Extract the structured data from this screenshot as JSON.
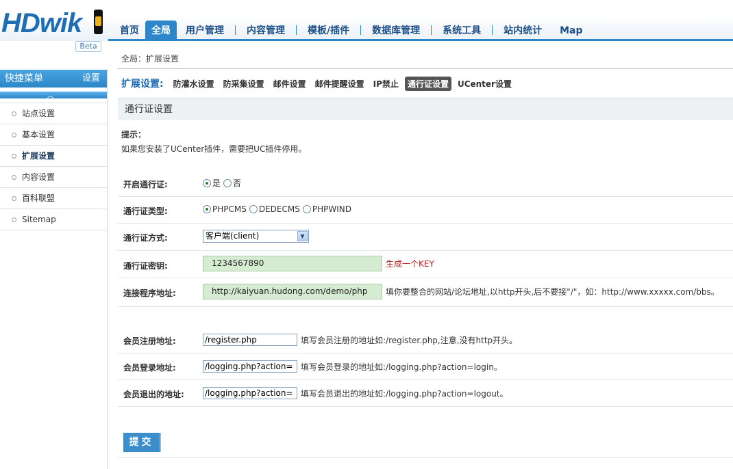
{
  "logo": {
    "text": "HDwik",
    "badge": "Beta"
  },
  "topnav": {
    "items": [
      {
        "label": "首页"
      },
      {
        "label": "全局",
        "active": true
      },
      {
        "label": "用户管理"
      },
      {
        "label": "内容管理"
      },
      {
        "label": "模板/插件"
      },
      {
        "label": "数据库管理"
      },
      {
        "label": "系统工具"
      },
      {
        "label": "站内统计"
      },
      {
        "label": "Map"
      }
    ]
  },
  "sidebar": {
    "title": "快捷菜单",
    "settings_link": "设置",
    "collapse_icon": "chevron-up-icon",
    "items": [
      {
        "label": "站点设置"
      },
      {
        "label": "基本设置"
      },
      {
        "label": "扩展设置",
        "active": true
      },
      {
        "label": "内容设置"
      },
      {
        "label": "百科联盟"
      },
      {
        "label": "Sitemap"
      }
    ]
  },
  "breadcrumb": "全局：扩展设置",
  "subnav": {
    "title": "扩展设置:",
    "items": [
      {
        "label": "防灌水设置"
      },
      {
        "label": "防采集设置"
      },
      {
        "label": "邮件设置"
      },
      {
        "label": "邮件提醒设置"
      },
      {
        "label": "IP禁止"
      },
      {
        "label": "通行证设置",
        "active": true
      },
      {
        "label": "UCenter设置"
      }
    ]
  },
  "section_title": "通行证设置",
  "tips": {
    "label": "提示：",
    "text": "如果您安装了UCenter插件，需要把UC插件停用。"
  },
  "form": {
    "enable": {
      "label": "开启通行证:",
      "options": [
        "是",
        "否"
      ],
      "selected": "是"
    },
    "type": {
      "label": "通行证类型:",
      "options": [
        "PHPCMS",
        "DEDECMS",
        "PHPWIND"
      ],
      "selected": "PHPCMS"
    },
    "mode": {
      "label": "通行证方式:",
      "value": "客户端(client)"
    },
    "key": {
      "label": "通行证密钥:",
      "value": "1234567890",
      "action": "生成一个KEY"
    },
    "api_url": {
      "label": "连接程序地址:",
      "value": "http://kaiyuan.hudong.com/demo/php",
      "hint": "填你要整合的网站/论坛地址,以http开头,后不要接\"/\"，如：http://www.xxxxx.com/bbs。"
    },
    "register": {
      "label": "会员注册地址:",
      "value": "/register.php",
      "hint": "填写会员注册的地址如:/register.php,注意,没有http开头。"
    },
    "login": {
      "label": "会员登录地址:",
      "value": "/logging.php?action=",
      "hint": "填写会员登录的地址如:/logging.php?action=login。"
    },
    "logout": {
      "label": "会员退出的地址:",
      "value": "/logging.php?action=",
      "hint": "填写会员退出的地址如:/logging.php?action=logout。"
    }
  },
  "submit_label": "提交",
  "colors": {
    "accent": "#2d86c9",
    "key_field": "#d6ecd2",
    "key_action": "#b22222"
  }
}
